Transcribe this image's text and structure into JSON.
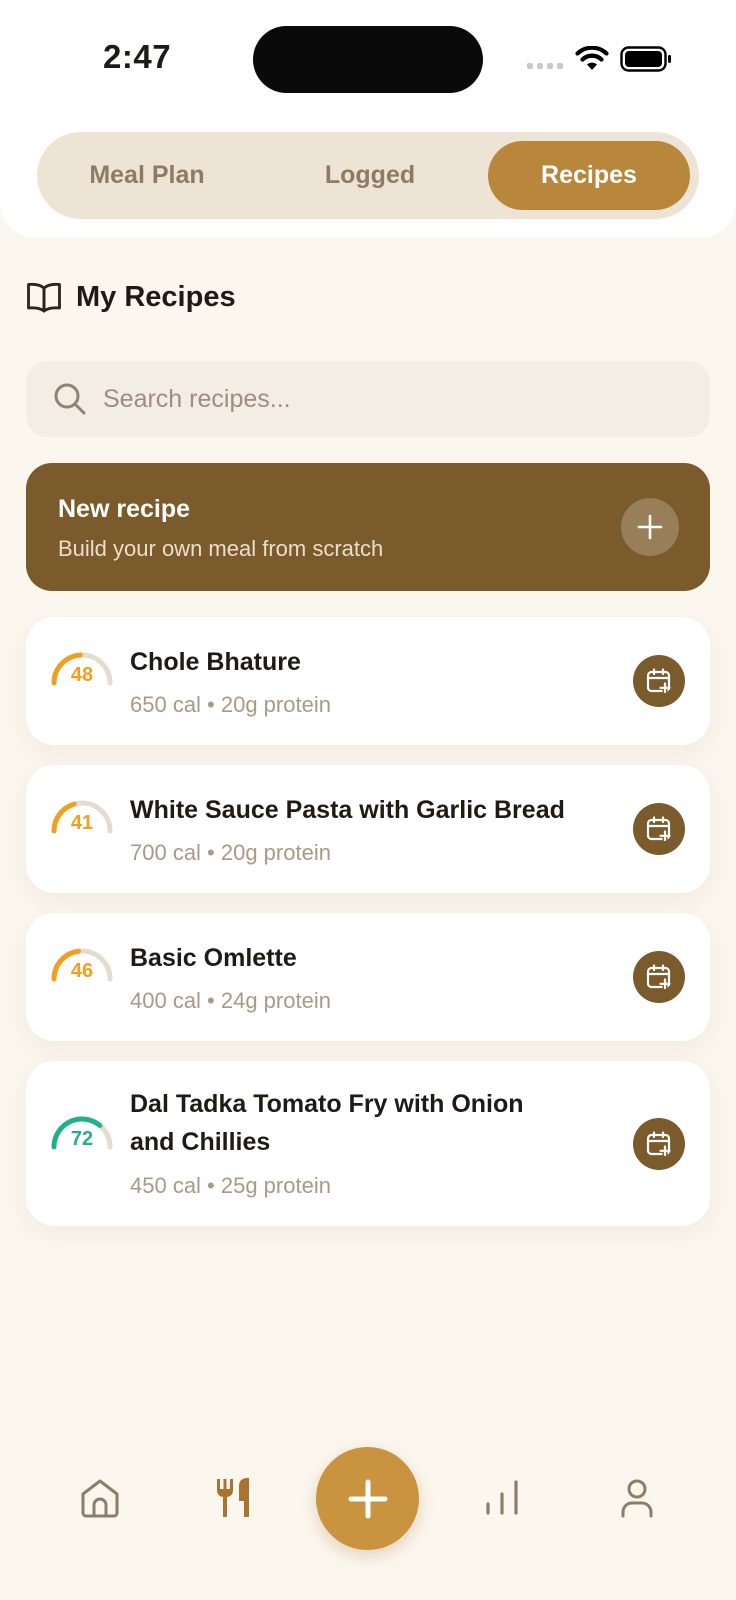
{
  "status_bar": {
    "time": "2:47"
  },
  "segmented": {
    "tabs": [
      {
        "label": "Meal Plan",
        "active": false
      },
      {
        "label": "Logged",
        "active": false
      },
      {
        "label": "Recipes",
        "active": true
      }
    ]
  },
  "section": {
    "title": "My Recipes",
    "icon": "open-book-icon"
  },
  "search": {
    "placeholder": "Search recipes..."
  },
  "new_recipe": {
    "title": "New recipe",
    "subtitle": "Build your own meal from scratch",
    "icon": "plus-icon"
  },
  "recipes": [
    {
      "score": "48",
      "score_fraction": 0.48,
      "score_color": "#f0a01e",
      "name": "Chole Bhature",
      "meta": "650 cal • 20g protein"
    },
    {
      "score": "41",
      "score_fraction": 0.41,
      "score_color": "#f0a01e",
      "name": "White Sauce Pasta with Garlic Bread",
      "meta": "700 cal • 20g protein"
    },
    {
      "score": "46",
      "score_fraction": 0.46,
      "score_color": "#f0a01e",
      "name": "Basic Omlette",
      "meta": "400 cal • 24g protein"
    },
    {
      "score": "72",
      "score_fraction": 0.72,
      "score_color": "#1fb28a",
      "name": "Dal Tadka Tomato Fry with Onion and Chillies",
      "meta": "450 cal • 25g protein"
    }
  ],
  "bottom_nav": {
    "items": [
      "home-icon",
      "fork-knife-icon",
      "add-icon",
      "stats-icon",
      "profile-icon"
    ],
    "active": "fork-knife-icon"
  },
  "colors": {
    "accent": "#b8873b",
    "card_dark": "#7b5a2b",
    "background": "#fbf6ee",
    "score_amber": "#f0a01e",
    "score_green": "#1fb28a"
  }
}
